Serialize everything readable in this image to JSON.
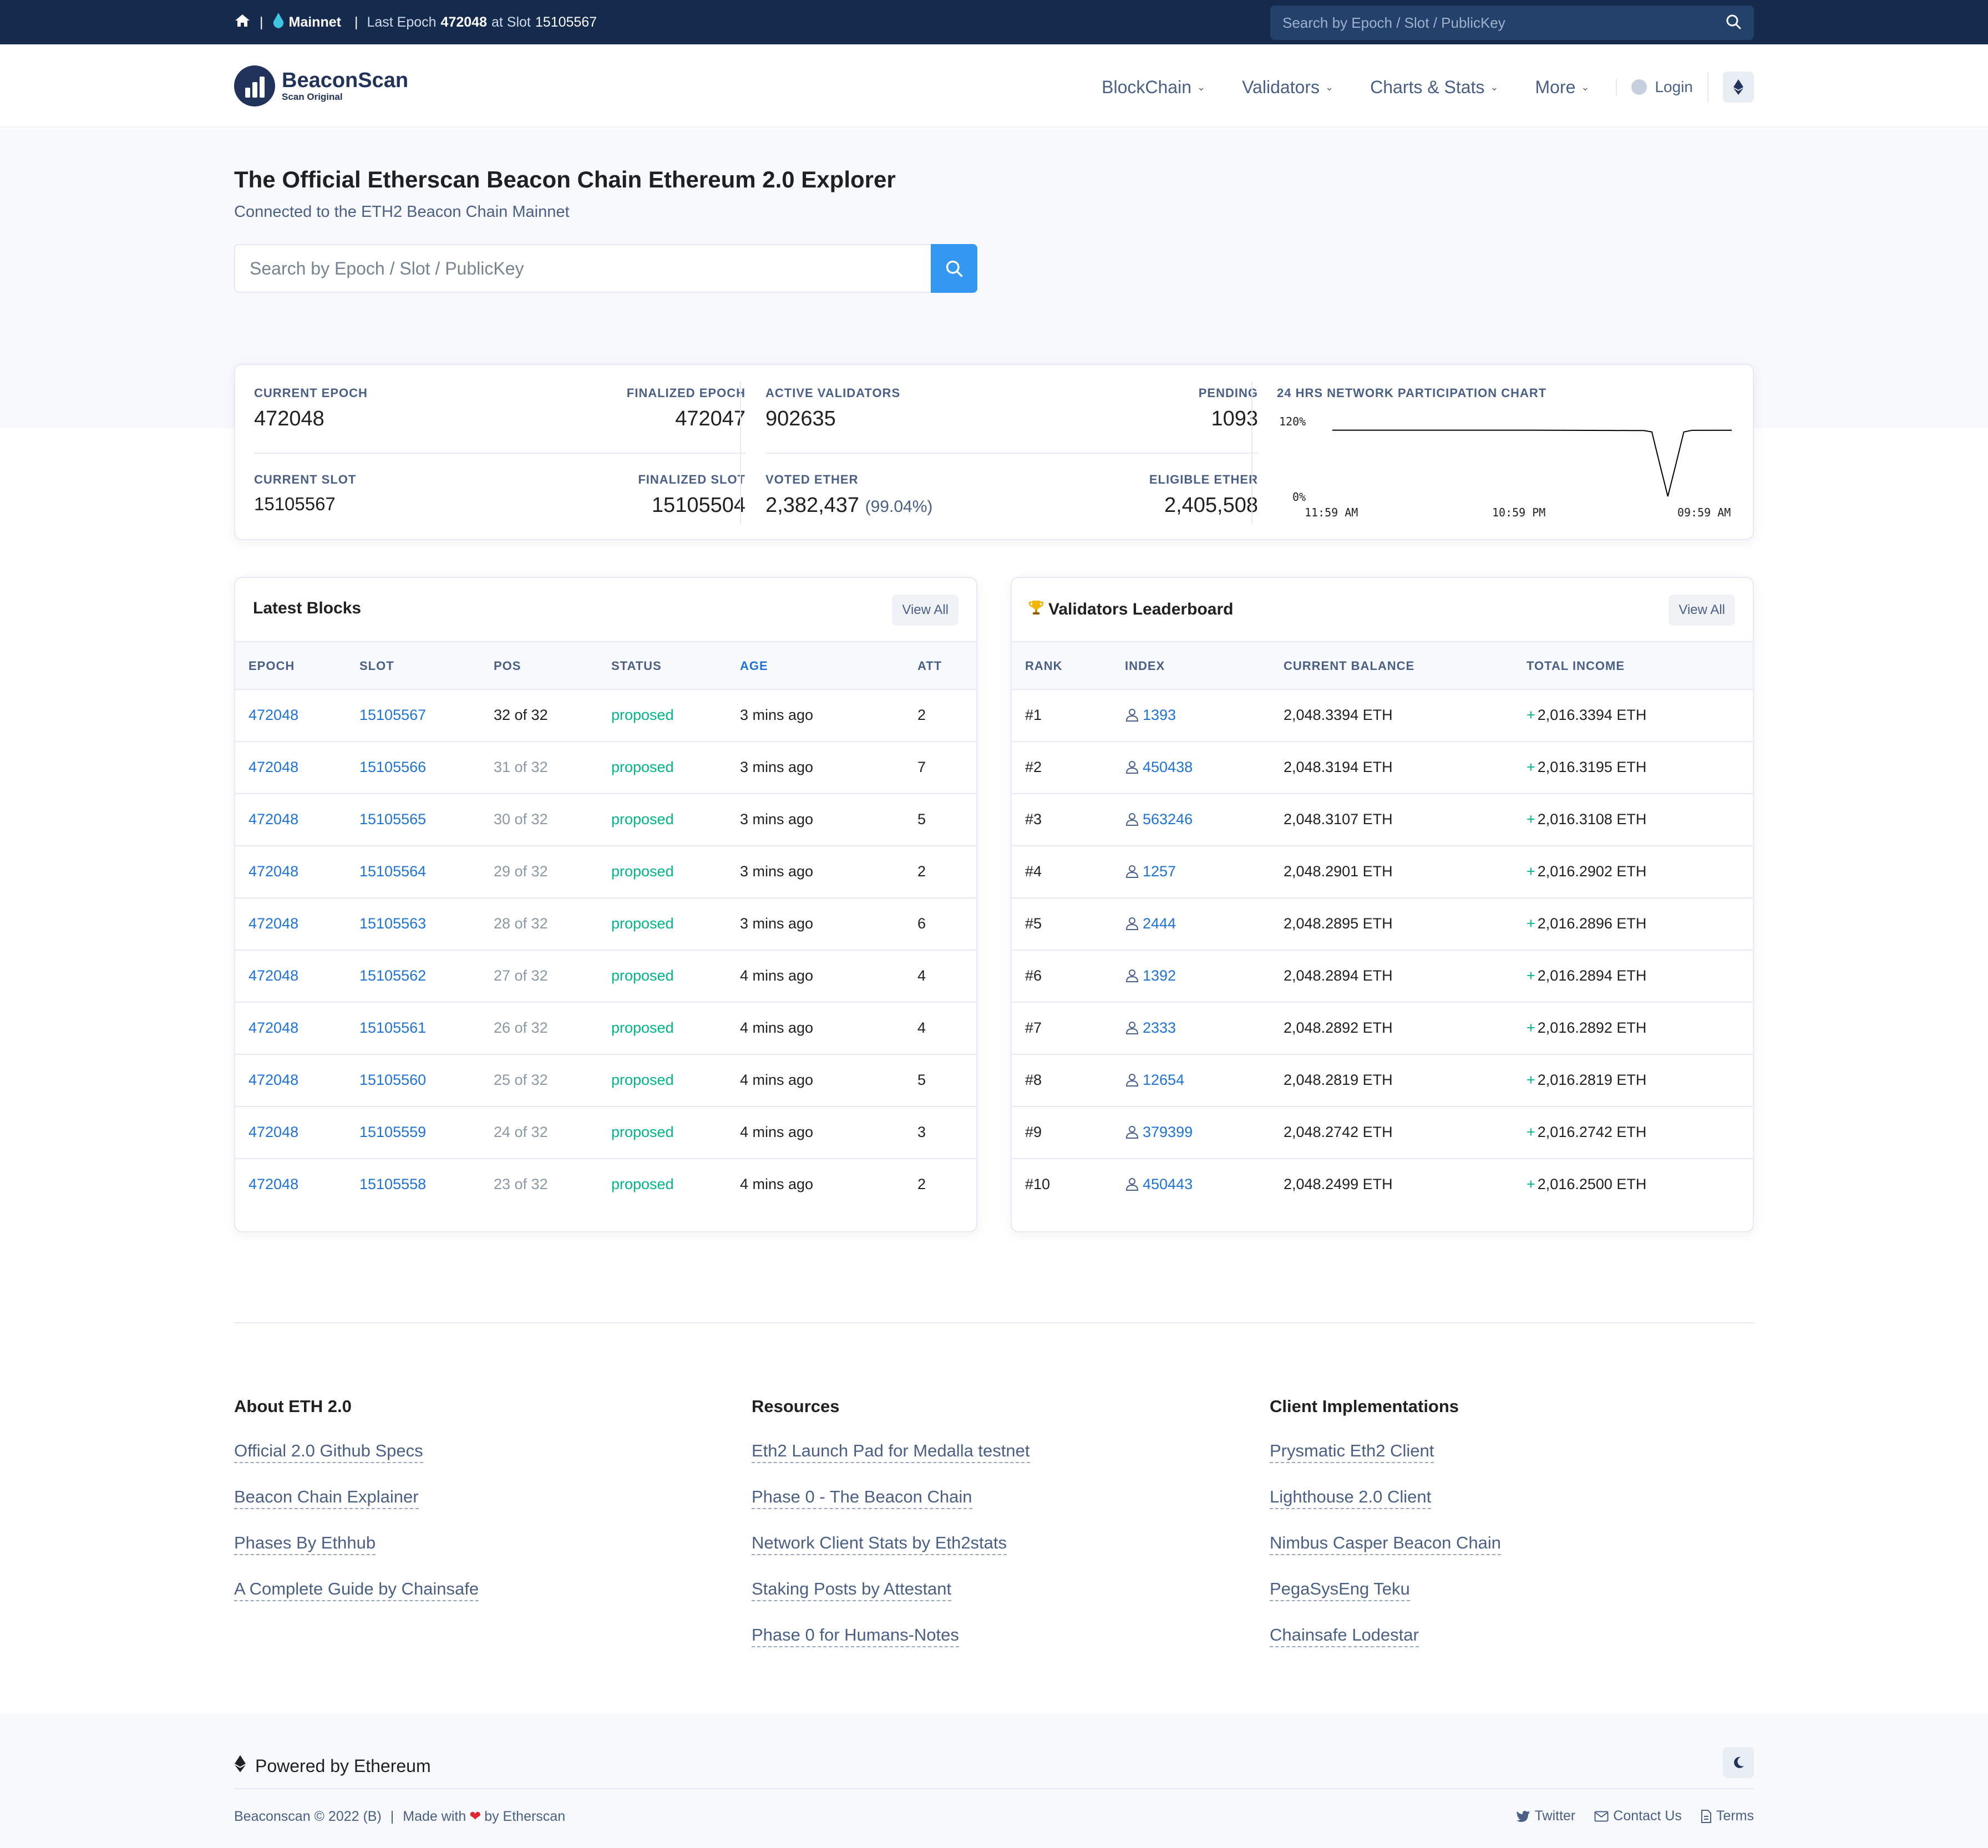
{
  "topbar": {
    "network": "Mainnet",
    "last_epoch_label": "Last Epoch",
    "last_epoch": "472048",
    "at_slot_label": "at Slot",
    "slot": "15105567",
    "search_placeholder": "Search by Epoch / Slot / PublicKey",
    "icons": [
      "home-icon",
      "eth-drop-icon",
      "search-icon"
    ]
  },
  "brand": {
    "name": "BeaconScan",
    "tagline": "Scan Original",
    "color": "#21325b"
  },
  "nav": {
    "items": [
      "BlockChain",
      "Validators",
      "Charts & Stats",
      "More"
    ],
    "login": "Login"
  },
  "hero": {
    "title": "The Official Etherscan Beacon Chain Ethereum 2.0 Explorer",
    "subtitle": "Connected to the ETH2 Beacon Chain Mainnet",
    "search_placeholder": "Search by Epoch / Slot / PublicKey",
    "accent": "#3498f1"
  },
  "stats": {
    "current_epoch_label": "CURRENT EPOCH",
    "current_epoch": "472048",
    "finalized_epoch_label": "FINALIZED EPOCH",
    "finalized_epoch": "472047",
    "current_slot_label": "CURRENT SLOT",
    "current_slot": "15105567",
    "finalized_slot_label": "FINALIZED SLOT",
    "finalized_slot": "15105504",
    "active_validators_label": "ACTIVE VALIDATORS",
    "active_validators": "902635",
    "pending_label": "PENDING",
    "pending": "1093",
    "voted_ether_label": "VOTED ETHER",
    "voted_ether": "2,382,437",
    "voted_ether_pct": "(99.04%)",
    "eligible_ether_label": "ELIGIBLE ETHER",
    "eligible_ether": "2,405,508",
    "chart_title": "24 HRS NETWORK PARTICIPATION CHART"
  },
  "chart_data": {
    "type": "line",
    "title": "24 HRS NETWORK PARTICIPATION CHART",
    "ylim": [
      0,
      120
    ],
    "y_ticks": [
      "120%",
      "0%"
    ],
    "x_ticks": [
      "11:59 AM",
      "10:59 PM",
      "09:59 AM"
    ],
    "series": [
      {
        "x": [
          0,
          10,
          20,
          30,
          40,
          50,
          55,
          60,
          65,
          70,
          75,
          78,
          80,
          82,
          84,
          86,
          88,
          90,
          100
        ],
        "values": [
          99.5,
          99.5,
          99.5,
          99.5,
          99.5,
          99.5,
          99.4,
          99.3,
          99.2,
          99.1,
          99.0,
          99.0,
          97,
          50,
          4,
          50,
          97,
          99.3,
          99.4
        ]
      }
    ],
    "grid": false,
    "color": "#000000"
  },
  "latest_blocks": {
    "title": "Latest Blocks",
    "view_all": "View All",
    "columns": [
      "EPOCH",
      "SLOT",
      "POS",
      "STATUS",
      "AGE",
      "ATT"
    ],
    "rows": [
      {
        "epoch": "472048",
        "slot": "15105567",
        "pos": "32 of 32",
        "status": "proposed",
        "age": "3 mins ago",
        "att": "2"
      },
      {
        "epoch": "472048",
        "slot": "15105566",
        "pos": "31 of 32",
        "status": "proposed",
        "age": "3 mins ago",
        "att": "7"
      },
      {
        "epoch": "472048",
        "slot": "15105565",
        "pos": "30 of 32",
        "status": "proposed",
        "age": "3 mins ago",
        "att": "5"
      },
      {
        "epoch": "472048",
        "slot": "15105564",
        "pos": "29 of 32",
        "status": "proposed",
        "age": "3 mins ago",
        "att": "2"
      },
      {
        "epoch": "472048",
        "slot": "15105563",
        "pos": "28 of 32",
        "status": "proposed",
        "age": "3 mins ago",
        "att": "6"
      },
      {
        "epoch": "472048",
        "slot": "15105562",
        "pos": "27 of 32",
        "status": "proposed",
        "age": "4 mins ago",
        "att": "4"
      },
      {
        "epoch": "472048",
        "slot": "15105561",
        "pos": "26 of 32",
        "status": "proposed",
        "age": "4 mins ago",
        "att": "4"
      },
      {
        "epoch": "472048",
        "slot": "15105560",
        "pos": "25 of 32",
        "status": "proposed",
        "age": "4 mins ago",
        "att": "5"
      },
      {
        "epoch": "472048",
        "slot": "15105559",
        "pos": "24 of 32",
        "status": "proposed",
        "age": "4 mins ago",
        "att": "3"
      },
      {
        "epoch": "472048",
        "slot": "15105558",
        "pos": "23 of 32",
        "status": "proposed",
        "age": "4 mins ago",
        "att": "2"
      }
    ]
  },
  "leaderboard": {
    "title": "Validators Leaderboard",
    "view_all": "View All",
    "columns": [
      "RANK",
      "INDEX",
      "CURRENT BALANCE",
      "TOTAL INCOME"
    ],
    "rows": [
      {
        "rank": "#1",
        "index": "1393",
        "balance": "2,048.3394 ETH",
        "income": "2,016.3394 ETH"
      },
      {
        "rank": "#2",
        "index": "450438",
        "balance": "2,048.3194 ETH",
        "income": "2,016.3195 ETH"
      },
      {
        "rank": "#3",
        "index": "563246",
        "balance": "2,048.3107 ETH",
        "income": "2,016.3108 ETH"
      },
      {
        "rank": "#4",
        "index": "1257",
        "balance": "2,048.2901 ETH",
        "income": "2,016.2902 ETH"
      },
      {
        "rank": "#5",
        "index": "2444",
        "balance": "2,048.2895 ETH",
        "income": "2,016.2896 ETH"
      },
      {
        "rank": "#6",
        "index": "1392",
        "balance": "2,048.2894 ETH",
        "income": "2,016.2894 ETH"
      },
      {
        "rank": "#7",
        "index": "2333",
        "balance": "2,048.2892 ETH",
        "income": "2,016.2892 ETH"
      },
      {
        "rank": "#8",
        "index": "12654",
        "balance": "2,048.2819 ETH",
        "income": "2,016.2819 ETH"
      },
      {
        "rank": "#9",
        "index": "379399",
        "balance": "2,048.2742 ETH",
        "income": "2,016.2742 ETH"
      },
      {
        "rank": "#10",
        "index": "450443",
        "balance": "2,048.2499 ETH",
        "income": "2,016.2500 ETH"
      }
    ]
  },
  "footer": {
    "columns": [
      {
        "title": "About ETH 2.0",
        "links": [
          "Official 2.0 Github Specs",
          "Beacon Chain Explainer",
          "Phases By Ethhub",
          "A Complete Guide by Chainsafe"
        ]
      },
      {
        "title": "Resources",
        "links": [
          "Eth2 Launch Pad for Medalla testnet",
          "Phase 0 - The Beacon Chain",
          "Network Client Stats by Eth2stats",
          "Staking Posts by Attestant",
          "Phase 0 for Humans-Notes"
        ]
      },
      {
        "title": "Client Implementations",
        "links": [
          "Prysmatic Eth2 Client",
          "Lighthouse 2.0 Client",
          "Nimbus Casper Beacon Chain",
          "PegaSysEng Teku",
          "Chainsafe Lodestar"
        ]
      }
    ],
    "powered_by": "Powered by Ethereum",
    "copyright": "Beaconscan © 2022 (B)",
    "made_with": "Made with",
    "by": "by Etherscan",
    "links": [
      "Twitter",
      "Contact Us",
      "Terms"
    ]
  }
}
